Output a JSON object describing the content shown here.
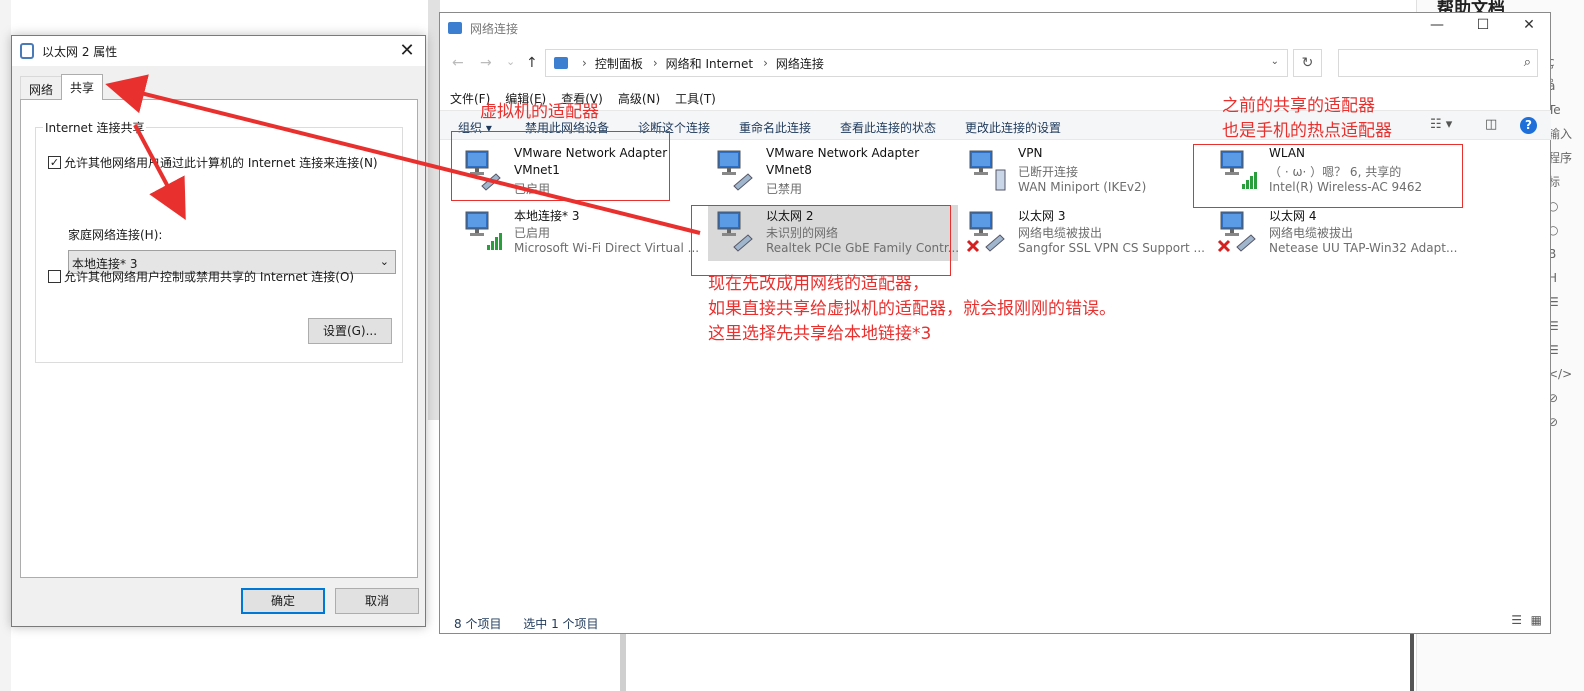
{
  "background": {
    "doc_title": "帮助文档",
    "side_glyphs": [
      "ç",
      "å",
      "Te",
      "输入",
      "程序",
      "",
      "",
      "标",
      "○",
      "○",
      "B",
      "H",
      "☰",
      "☰",
      "☰",
      "</>",
      "⊘",
      "⊘"
    ]
  },
  "dialog": {
    "title": "以太网 2 属性",
    "close": "✕",
    "tabs": [
      "网络",
      "共享"
    ],
    "active_tab": "共享",
    "group_title": "Internet 连接共享",
    "allow_share_label": "允许其他网络用户通过此计算机的 Internet 连接来连接(N)",
    "allow_share_checked": "✓",
    "home_network_label": "家庭网络连接(H):",
    "home_network_value": "本地连接* 3",
    "allow_control_label": "允许其他网络用户控制或禁用共享的 Internet 连接(O)",
    "settings_button": "设置(G)...",
    "ok_button": "确定",
    "cancel_button": "取消"
  },
  "explorer": {
    "title": "网络连接",
    "window_controls": {
      "minimize": "—",
      "maximize": "☐",
      "close": "✕"
    },
    "nav": {
      "back": "←",
      "forward": "→",
      "recent": "⌄",
      "up": "↑",
      "refresh": "↻",
      "search_icon": "⌕"
    },
    "breadcrumb": [
      "控制面板",
      "网络和 Internet",
      "网络连接"
    ],
    "search_placeholder": "",
    "menu": [
      "文件(F)",
      "编辑(E)",
      "查看(V)",
      "高级(N)",
      "工具(T)"
    ],
    "commands": [
      "组织 ▾",
      "禁用此网络设备",
      "诊断这个连接",
      "重命名此连接",
      "查看此连接的状态",
      "更改此连接的设置"
    ],
    "items": [
      {
        "name": "VMware Network Adapter",
        "line2": "VMnet1",
        "line3": "已启用",
        "icon": "network-adapter-icon",
        "status": "enabled"
      },
      {
        "name": "VMware Network Adapter",
        "line2": "VMnet8",
        "line3": "已禁用",
        "icon": "network-adapter-icon",
        "status": "disabled"
      },
      {
        "name": "VPN",
        "line2": "已断开连接",
        "line3": "WAN Miniport (IKEv2)",
        "icon": "vpn-icon",
        "status": "vpn"
      },
      {
        "name": "WLAN",
        "line2": "（ · ω· ）嗯？ 6, 共享的",
        "line3": "Intel(R) Wireless-AC 9462",
        "icon": "wlan-icon",
        "status": "wifi"
      },
      {
        "name": "本地连接* 3",
        "line2": "已启用",
        "line3": "Microsoft Wi-Fi Direct Virtual ...",
        "icon": "wlan-icon",
        "status": "wifi"
      },
      {
        "name": "以太网 2",
        "line2": "未识别的网络",
        "line3": "Realtek PCIe GbE Family Contr...",
        "icon": "ethernet-icon",
        "status": "enabled"
      },
      {
        "name": "以太网 3",
        "line2": "网络电缆被拔出",
        "line3": "Sangfor SSL VPN CS Support ...",
        "icon": "ethernet-icon",
        "status": "unplugged"
      },
      {
        "name": "以太网 4",
        "line2": "网络电缆被拔出",
        "line3": "Netease UU TAP-Win32 Adapt...",
        "icon": "ethernet-icon",
        "status": "unplugged"
      }
    ],
    "status_items": "8 个项目",
    "status_selected": "选中 1 个项目"
  },
  "annotations": {
    "vm_adapter": "虚拟机的适配器",
    "prev_shared_1": "之前的共享的适配器",
    "prev_shared_2": "也是手机的热点适配器",
    "note_1": "现在先改成用网线的适配器，",
    "note_2": "如果直接共享给虚拟机的适配器，就会报刚刚的错误。",
    "note_3": "这里选择先共享给本地链接*3",
    "color": "#e8312f"
  }
}
